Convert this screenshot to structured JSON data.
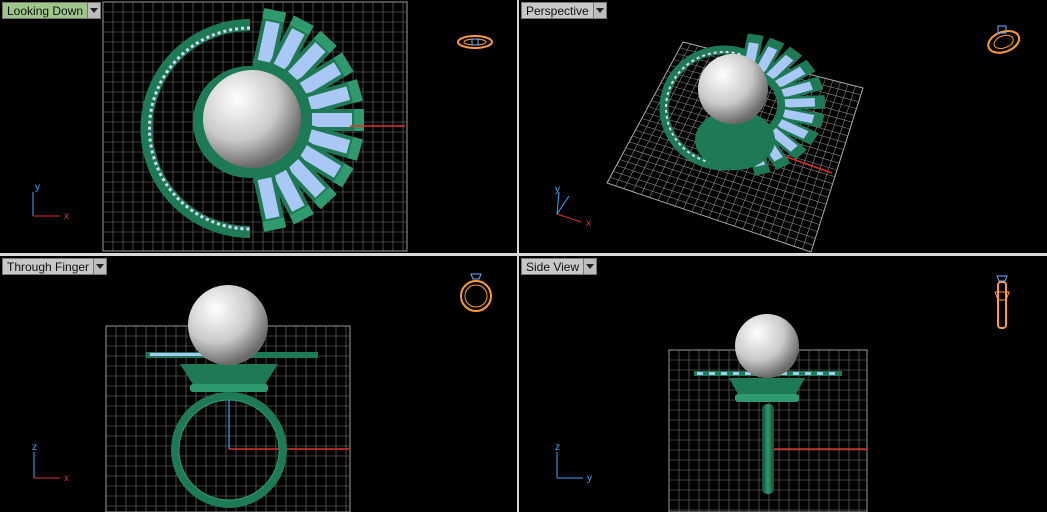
{
  "viewports": {
    "top_left": {
      "title": "Looking Down",
      "axis_v": "y",
      "axis_h": "x"
    },
    "top_right": {
      "title": "Perspective",
      "axis_v": "y",
      "axis_h": "x"
    },
    "bottom_left": {
      "title": "Through Finger",
      "axis_v": "z",
      "axis_h": "x"
    },
    "bottom_right": {
      "title": "Side View",
      "axis_v": "z",
      "axis_h": "y"
    }
  },
  "colors": {
    "active_label": "#9fc68a",
    "label": "#c8c8c8",
    "grid": "#9a9a9a",
    "metal_green": "#1e7a55",
    "gem_blue": "#a9c8f5",
    "pearl": "#f2f2f2",
    "axis_x": "#e0302a",
    "axis_y": "#3fa7ff",
    "nav_icon": "#ff9a3c"
  },
  "icons": {
    "view_menu": "chevron-down-icon",
    "nav_cube": "ring-orientation-icon"
  }
}
